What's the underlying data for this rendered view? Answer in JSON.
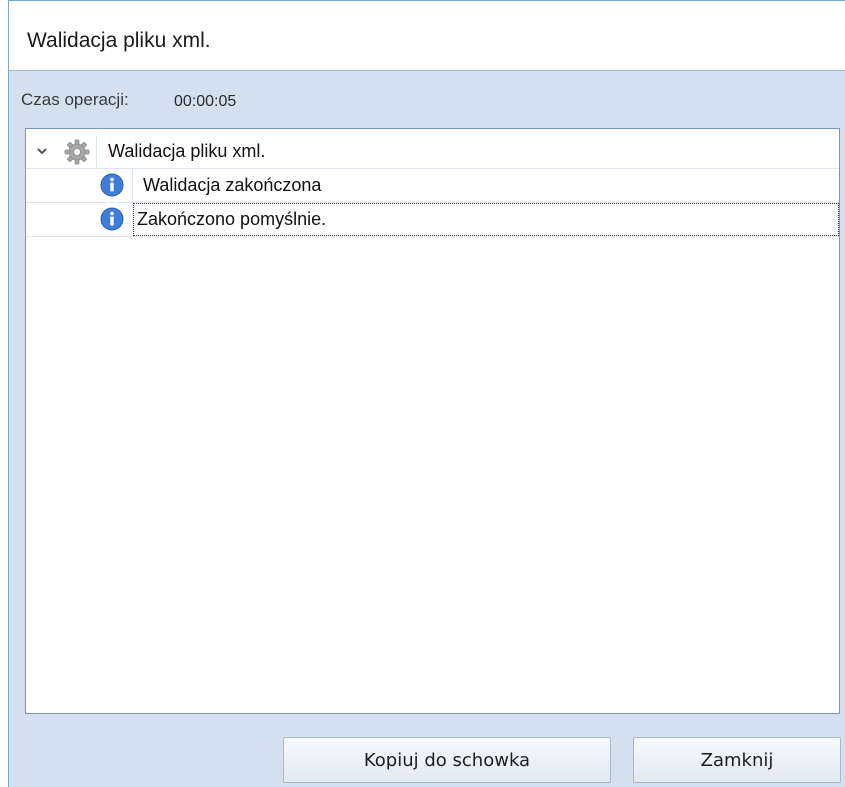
{
  "window": {
    "title": "Walidacja pliku xml."
  },
  "operation": {
    "label": "Czas operacji:",
    "value": "00:00:05"
  },
  "tree": {
    "root": {
      "label": "Walidacja pliku xml.",
      "icon": "gear-icon",
      "expanded": true
    },
    "children": [
      {
        "label": "Walidacja zakończona",
        "icon": "info-icon"
      },
      {
        "label": "Zakończono pomyślnie.",
        "icon": "info-icon",
        "focused": true
      }
    ]
  },
  "buttons": {
    "copy": "Kopiuj do schowka",
    "close": "Zamknij"
  },
  "colors": {
    "window_bg": "#d4e0ef",
    "border": "#7fa3cf",
    "info_blue": "#3f7ed8"
  }
}
